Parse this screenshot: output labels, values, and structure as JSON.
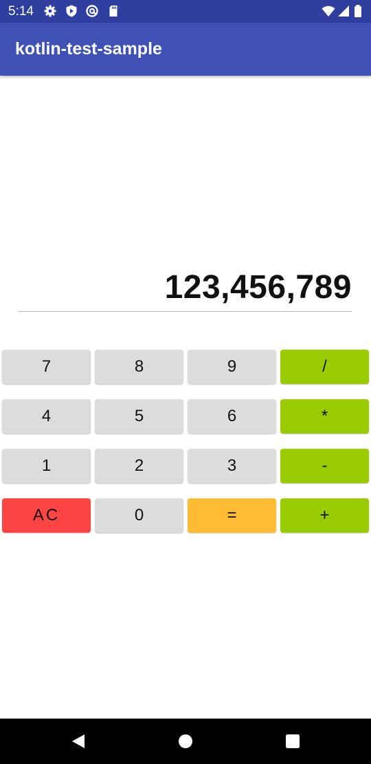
{
  "status_bar": {
    "time": "5:14",
    "left_icons": [
      "gear-icon",
      "shield-icon",
      "at-sign-icon",
      "sd-card-icon"
    ],
    "right_icons": [
      "wifi-icon",
      "signal-icon",
      "battery-icon"
    ]
  },
  "app_bar": {
    "title": "kotlin-test-sample"
  },
  "display": {
    "value": "123,456,789"
  },
  "keypad": {
    "rows": [
      [
        {
          "label": "7",
          "color": "#dcdcdc"
        },
        {
          "label": "8",
          "color": "#dcdcdc"
        },
        {
          "label": "9",
          "color": "#dcdcdc"
        },
        {
          "label": "/",
          "color": "#99cc00"
        }
      ],
      [
        {
          "label": "4",
          "color": "#dcdcdc"
        },
        {
          "label": "5",
          "color": "#dcdcdc"
        },
        {
          "label": "6",
          "color": "#dcdcdc"
        },
        {
          "label": "*",
          "color": "#99cc00"
        }
      ],
      [
        {
          "label": "1",
          "color": "#dcdcdc"
        },
        {
          "label": "2",
          "color": "#dcdcdc"
        },
        {
          "label": "3",
          "color": "#dcdcdc"
        },
        {
          "label": "-",
          "color": "#99cc00"
        }
      ],
      [
        {
          "label": "AC",
          "color": "#ff4444"
        },
        {
          "label": "0",
          "color": "#dcdcdc"
        },
        {
          "label": "=",
          "color": "#ffbb33"
        },
        {
          "label": "+",
          "color": "#99cc00"
        }
      ]
    ]
  },
  "nav_bar": {
    "buttons": [
      "back-icon",
      "home-icon",
      "recents-icon"
    ]
  },
  "colors": {
    "status_bar": "#303f9f",
    "app_bar": "#3f51b5",
    "number_key": "#dcdcdc",
    "operator_key": "#99cc00",
    "equals_key": "#ffbb33",
    "clear_key": "#ff4444"
  }
}
